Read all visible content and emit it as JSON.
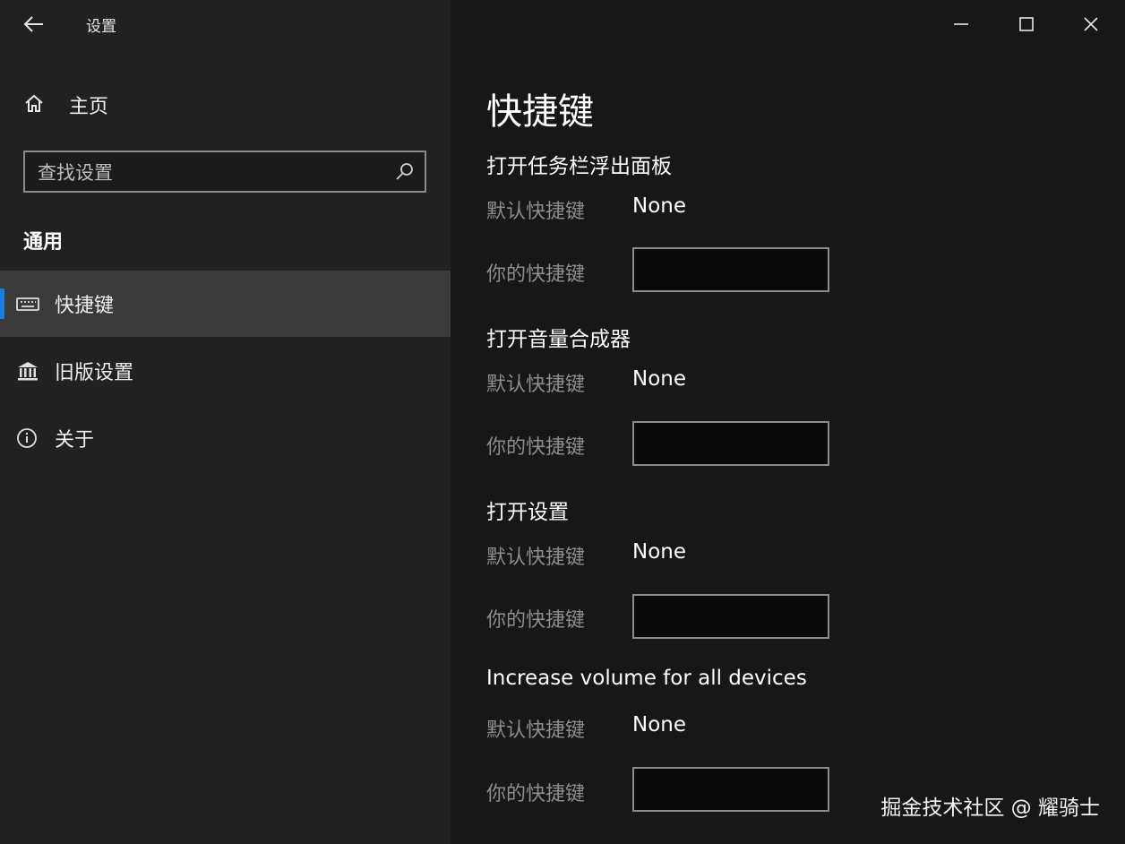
{
  "window": {
    "title": "设置",
    "controls": [
      "minimize",
      "maximize",
      "close"
    ]
  },
  "sidebar": {
    "home_label": "主页",
    "search_placeholder": "查找设置",
    "group_title": "通用",
    "items": [
      {
        "label": "快捷键",
        "icon": "keyboard-icon",
        "selected": true
      },
      {
        "label": "旧版设置",
        "icon": "bank-icon",
        "selected": false
      },
      {
        "label": "关于",
        "icon": "info-icon",
        "selected": false
      }
    ]
  },
  "main": {
    "page_title": "快捷键",
    "sections": [
      {
        "title": "打开任务栏浮出面板",
        "default_label": "默认快捷键",
        "default_value": "None",
        "yours_label": "你的快捷键",
        "yours_value": ""
      },
      {
        "title": "打开音量合成器",
        "default_label": "默认快捷键",
        "default_value": "None",
        "yours_label": "你的快捷键",
        "yours_value": ""
      },
      {
        "title": "打开设置",
        "default_label": "默认快捷键",
        "default_value": "None",
        "yours_label": "你的快捷键",
        "yours_value": ""
      },
      {
        "title": "Increase volume for all devices",
        "default_label": "默认快捷键",
        "default_value": "None",
        "yours_label": "你的快捷键",
        "yours_value": ""
      }
    ]
  },
  "watermark": "掘金技术社区 @ 耀骑士",
  "colors": {
    "sidebar_bg": "#212121",
    "main_bg": "#171717",
    "selected_bg": "#3a3a3a",
    "accent": "#1a7be0"
  }
}
